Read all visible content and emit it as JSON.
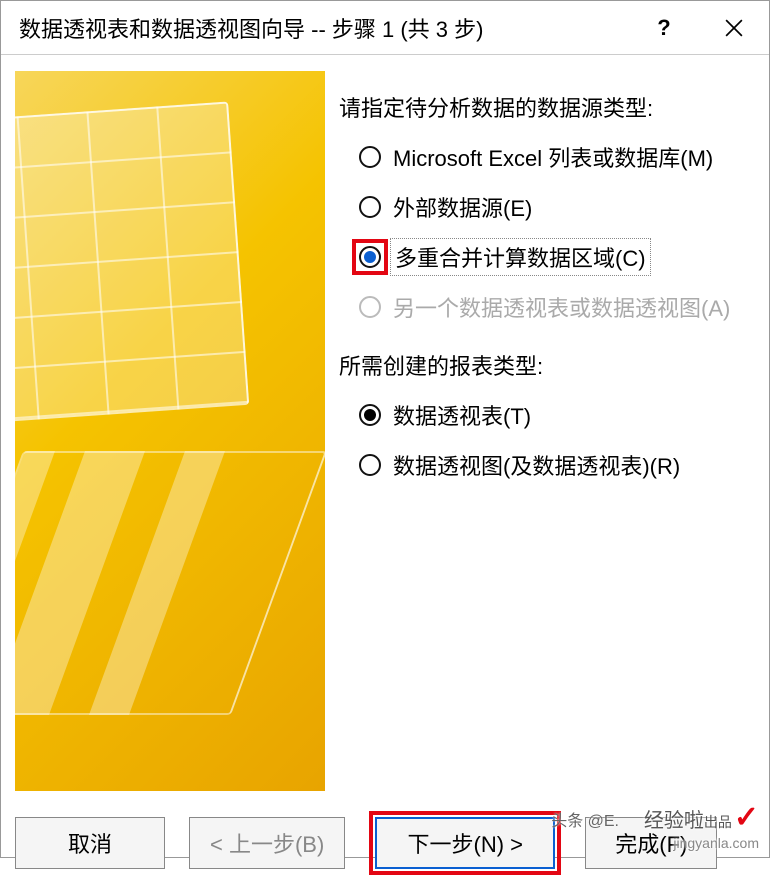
{
  "titlebar": {
    "title": "数据透视表和数据透视图向导 -- 步骤 1 (共 3 步)",
    "help": "?",
    "close_icon": "close-icon"
  },
  "section1": {
    "label": "请指定待分析数据的数据源类型:",
    "options": [
      {
        "label": "Microsoft Excel 列表或数据库(M)",
        "checked": false,
        "disabled": false,
        "highlighted": false
      },
      {
        "label": "外部数据源(E)",
        "checked": false,
        "disabled": false,
        "highlighted": false
      },
      {
        "label": "多重合并计算数据区域(C)",
        "checked": true,
        "disabled": false,
        "highlighted": true
      },
      {
        "label": "另一个数据透视表或数据透视图(A)",
        "checked": false,
        "disabled": true,
        "highlighted": false
      }
    ]
  },
  "section2": {
    "label": "所需创建的报表类型:",
    "options": [
      {
        "label": "数据透视表(T)",
        "checked": true
      },
      {
        "label": "数据透视图(及数据透视表)(R)",
        "checked": false
      }
    ]
  },
  "buttons": {
    "cancel": "取消",
    "back": "< 上一步(B)",
    "next": "下一步(N) >",
    "finish": "完成(F)"
  },
  "watermark": {
    "attribution": "头条 @E.",
    "brand": "经验啦",
    "suffix": "出品",
    "domain": "jingyanla.com"
  }
}
